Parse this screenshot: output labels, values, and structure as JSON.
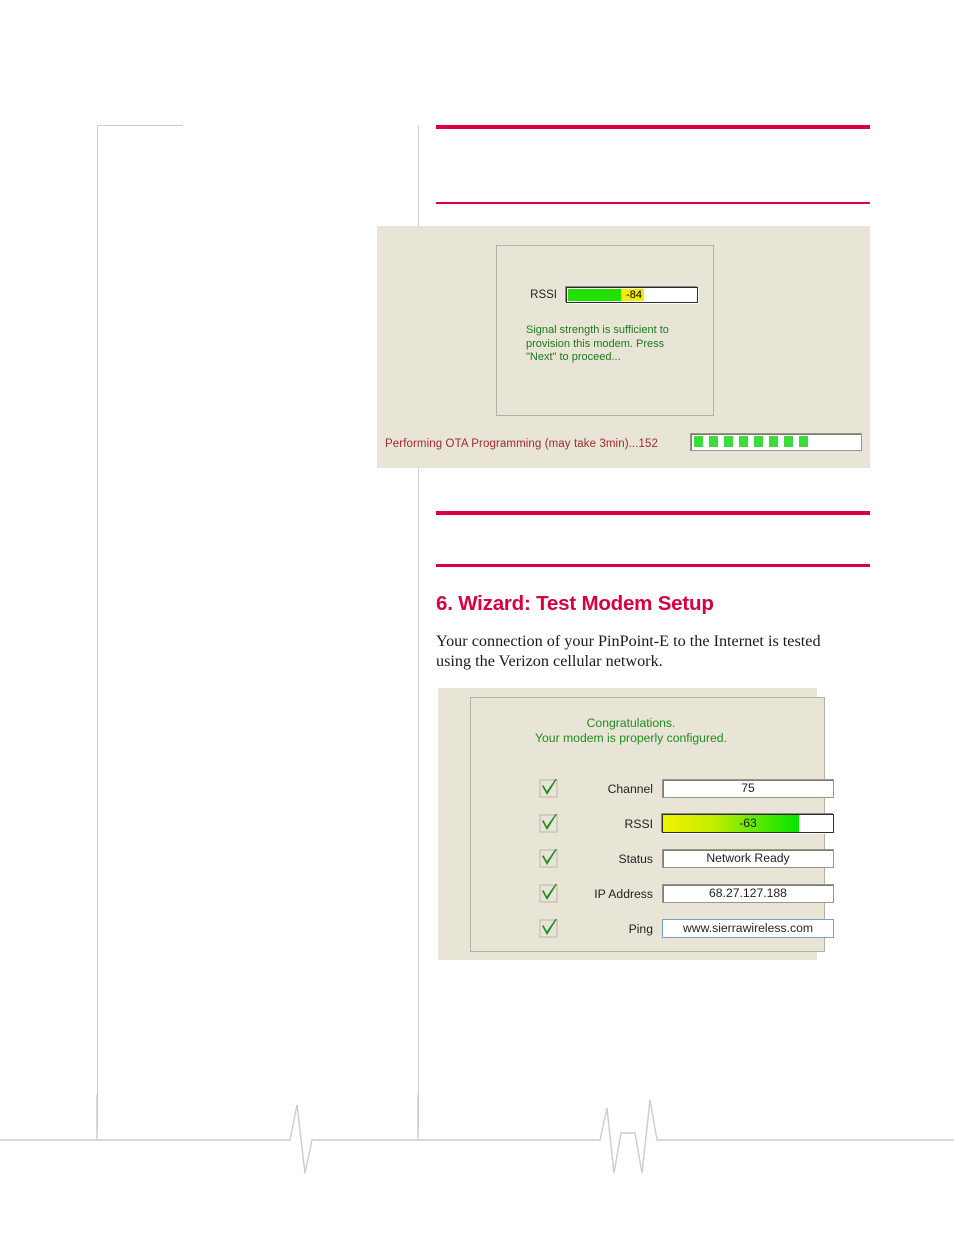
{
  "page": {
    "accent_color": "#d90041",
    "frame_color": "#cccccc"
  },
  "section": {
    "heading": "6. Wizard: Test Modem Setup",
    "body": "Your connection of your PinPoint-E to the Internet is tested using the Verizon cellular network."
  },
  "figure_ota": {
    "rssi_label": "RSSI",
    "rssi_value": "-84",
    "rssi_green_pct": 40,
    "rssi_yellow_pct": 18,
    "message": "Signal strength is sufficient to provision this modem.  Press \"Next\" to proceed...",
    "status_text": "Performing OTA Programming (may take 3min)...152",
    "progress_blocks": 8,
    "progress_total": 16,
    "bg_color": "#e8e5d7",
    "green_color": "#22e000",
    "yellow_color": "#f2ea00",
    "status_color": "#9e2b2b",
    "message_color": "#1b7a1b"
  },
  "figure_test": {
    "congrats_line1": "Congratulations.",
    "congrats_line2": "Your modem is properly configured.",
    "congrats_color": "#1f8c1f",
    "rows": [
      {
        "checked": true,
        "label": "Channel",
        "value": "75",
        "type": "text"
      },
      {
        "checked": true,
        "label": "RSSI",
        "value": "-63",
        "type": "meter",
        "fill_pct": 80
      },
      {
        "checked": true,
        "label": "Status",
        "value": "Network Ready",
        "type": "text"
      },
      {
        "checked": true,
        "label": "IP Address",
        "value": "68.27.127.188",
        "type": "text"
      },
      {
        "checked": true,
        "label": "Ping",
        "value": "www.sierrawireless.com",
        "type": "text",
        "focused": true
      }
    ],
    "check_color": "#1f8f1f",
    "bg_color": "#e8e5d7"
  }
}
